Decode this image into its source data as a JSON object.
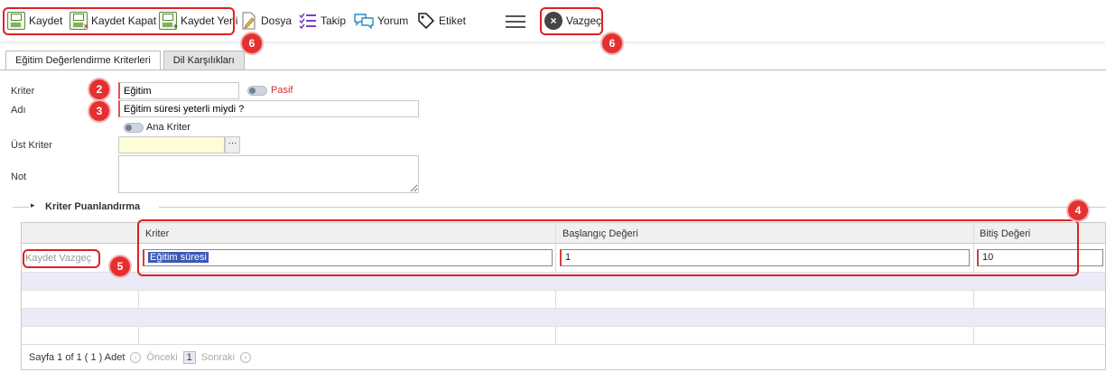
{
  "toolbar": {
    "save": "Kaydet",
    "save_close": "Kaydet Kapat",
    "save_new": "Kaydet Yeni",
    "file": "Dosya",
    "follow": "Takip",
    "comment": "Yorum",
    "tag": "Etiket",
    "cancel": "Vazgeç"
  },
  "badges": {
    "b2": "2",
    "b3": "3",
    "b4": "4",
    "b5": "5",
    "b6a": "6",
    "b6b": "6"
  },
  "tabs": [
    "Eğitim Değerlendirme Kriterleri",
    "Dil Karşılıkları"
  ],
  "form": {
    "criteria_label": "Kriter",
    "criteria_value": "Eğitim",
    "passive_label": "Pasif",
    "name_label": "Adı",
    "name_value": "Eğitim süresi yeterli miydi ?",
    "main_criteria_label": "Ana Kriter",
    "parent_label": "Üst Kriter",
    "parent_button": "···",
    "note_label": "Not"
  },
  "section": {
    "title": "Kriter Puanlandırma",
    "arrow": "▸"
  },
  "grid": {
    "columns": [
      "Kriter",
      "Başlangıç Değeri",
      "Bitiş Değeri"
    ],
    "row_actions": "Kaydet Vazgeç",
    "edit_row": {
      "criteria": "Eğitim süresi",
      "start": "1",
      "end": "10"
    }
  },
  "pager": {
    "info": "Sayfa 1 of 1 ( 1 ) Adet",
    "prev": "Önceki",
    "page": "1",
    "next": "Sonraki",
    "prev_icon": "‹",
    "next_icon": "›"
  },
  "colors": {
    "accent_red": "#e02020",
    "badge": "#e53030",
    "required_border": "#e05050"
  }
}
